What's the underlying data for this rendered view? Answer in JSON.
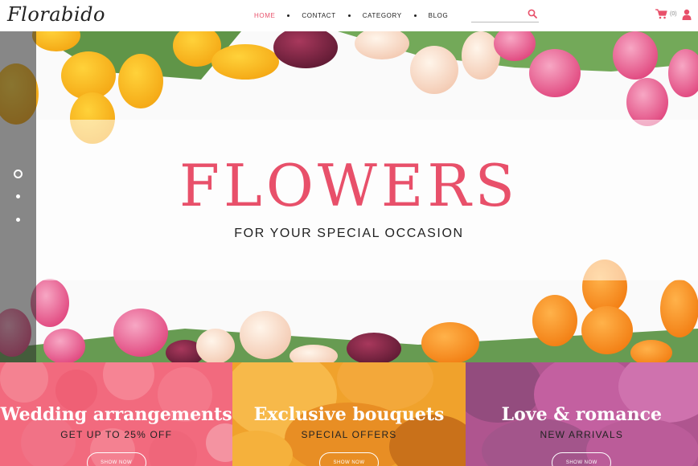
{
  "brand": {
    "logo": "Florabido"
  },
  "nav": {
    "items": [
      {
        "label": "HOME",
        "active": true
      },
      {
        "label": "CONTACT",
        "active": false
      },
      {
        "label": "CATEGORY",
        "active": false
      },
      {
        "label": "BLOG",
        "active": false
      }
    ]
  },
  "search": {
    "placeholder": "",
    "value": ""
  },
  "cart": {
    "count": "(0)"
  },
  "hero": {
    "title": "FLOWERS",
    "subtitle": "FOR YOUR SPECIAL OCCASION",
    "slides": 3,
    "active_slide": 1
  },
  "promos": [
    {
      "title": "Wedding arrangements",
      "subtitle": "GET UP TO 25% OFF",
      "button": "SHOW NOW"
    },
    {
      "title": "Exclusive bouquets",
      "subtitle": "SPECIAL OFFERS",
      "button": "SHOW NOW"
    },
    {
      "title": "Love & romance",
      "subtitle": "NEW ARRIVALS",
      "button": "SHOW NOW"
    }
  ],
  "colors": {
    "accent": "#e8506a",
    "promo_wedding": "#f26a7e",
    "promo_exclusive": "#f0a22c",
    "promo_love": "#b0568f"
  },
  "icons": [
    "search-icon",
    "cart-icon",
    "user-icon"
  ]
}
